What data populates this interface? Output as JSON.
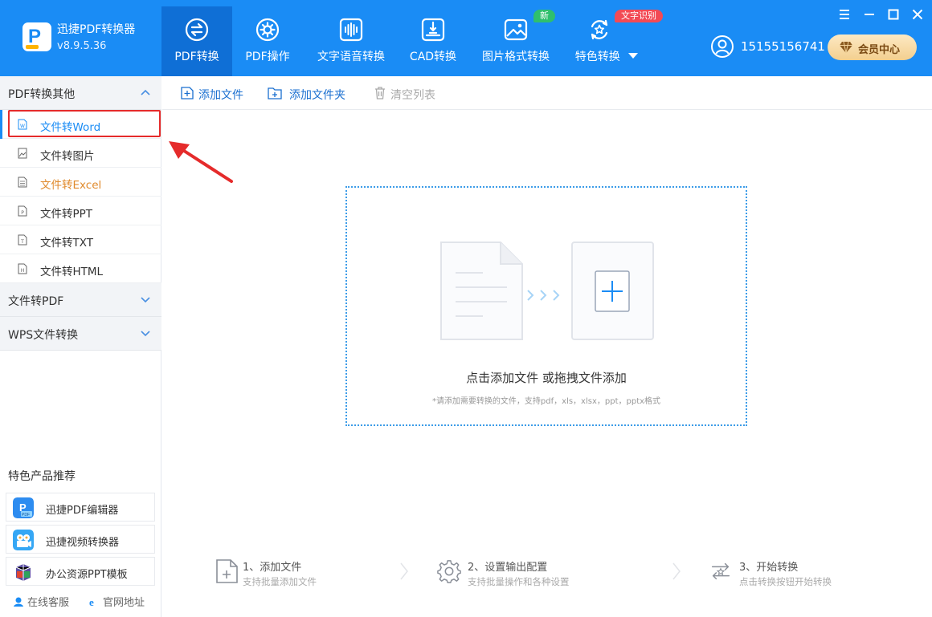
{
  "app": {
    "name": "迅捷PDF转换器",
    "version": "v8.9.5.36"
  },
  "nav": {
    "tabs": [
      {
        "label": "PDF转换",
        "icon": "convert-arrows-icon",
        "active": true
      },
      {
        "label": "PDF操作",
        "icon": "gear-icon"
      },
      {
        "label": "文字语音转换",
        "icon": "soundwave-icon"
      },
      {
        "label": "CAD转换",
        "icon": "cad-icon"
      },
      {
        "label": "图片格式转换",
        "icon": "image-icon",
        "badge": "新"
      },
      {
        "label": "特色转换",
        "icon": "star-refresh-icon",
        "badge": "文字识别",
        "has_dropdown": true
      }
    ]
  },
  "account": {
    "phone": "15155156741",
    "vip_label": "会员中心"
  },
  "colors": {
    "brand": "#1a8cf5",
    "nav_active": "#0f6fd6",
    "highlight": "#e52b2b",
    "badge_new": "#2fbf6d",
    "badge_ocr": "#f24a55"
  },
  "sidebar": {
    "sections": [
      {
        "title": "PDF转换其他",
        "expanded": true,
        "items": [
          {
            "label": "文件转Word",
            "active": true
          },
          {
            "label": "文件转图片"
          },
          {
            "label": "文件转Excel"
          },
          {
            "label": "文件转PPT"
          },
          {
            "label": "文件转TXT"
          },
          {
            "label": "文件转HTML"
          }
        ]
      },
      {
        "title": "文件转PDF",
        "expanded": false
      },
      {
        "title": "WPS文件转换",
        "expanded": false
      }
    ],
    "featured_title": "特色产品推荐",
    "featured": [
      {
        "label": "迅捷PDF编辑器"
      },
      {
        "label": "迅捷视频转换器"
      },
      {
        "label": "办公资源PPT模板"
      }
    ],
    "footer": {
      "service": "在线客服",
      "website": "官网地址"
    }
  },
  "toolbar": {
    "add_file": "添加文件",
    "add_folder": "添加文件夹",
    "clear_list": "清空列表"
  },
  "dropzone": {
    "title": "点击添加文件 或拖拽文件添加",
    "hint": "*请添加需要转换的文件，支持pdf，xls，xlsx，ppt，pptx格式"
  },
  "steps": [
    {
      "title": "1、添加文件",
      "desc": "支持批量添加文件"
    },
    {
      "title": "2、设置输出配置",
      "desc": "支持批量操作和各种设置"
    },
    {
      "title": "3、开始转换",
      "desc": "点击转换按钮开始转换"
    }
  ]
}
